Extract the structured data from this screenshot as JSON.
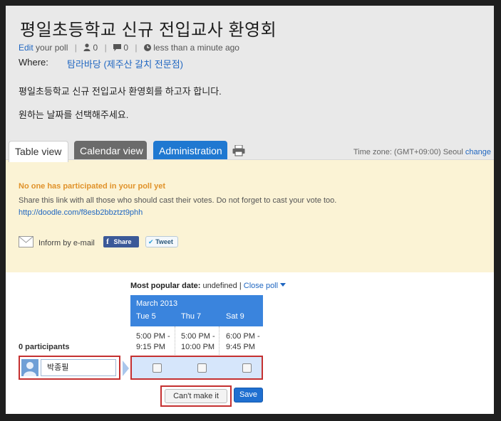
{
  "poll": {
    "title": "평일초등학교 신규 전입교사 환영회",
    "meta": {
      "edit_link": "Edit",
      "edit_suffix": "your poll",
      "participant_count": "0",
      "comment_count": "0",
      "updated": "less than a minute ago"
    },
    "where_label": "Where:",
    "where_value": "탐라바당 (제주산 갈치 전문점)",
    "description_line1": "평일초등학교 신규 전입교사 환영회를 하고자 합니다.",
    "description_line2": "원하는 날짜를 선택해주세요."
  },
  "tabs": {
    "table_view": "Table view",
    "calendar_view": "Calendar view",
    "administration": "Administration"
  },
  "timezone": {
    "label": "Time zone: (GMT+09:00) Seoul",
    "change_link": "change"
  },
  "notice": {
    "title": "No one has participated in your poll yet",
    "text": "Share this link with all those who should cast their votes. Do not forget to cast your vote too.",
    "link": "http://doodle.com/f8esb2bbztzt9phh",
    "email_label": "Inform by e-mail",
    "facebook_label": "Share",
    "twitter_label": "Tweet"
  },
  "popular": {
    "label": "Most popular date:",
    "value": "undefined",
    "separator": "|",
    "close_link": "Close poll"
  },
  "table": {
    "month": "March 2013",
    "participants_label": "0 participants",
    "columns": [
      {
        "day": "Tue 5",
        "time_start": "5:00 PM -",
        "time_end": "9:15 PM"
      },
      {
        "day": "Thu 7",
        "time_start": "5:00 PM -",
        "time_end": "10:00 PM"
      },
      {
        "day": "Sat 9",
        "time_start": "6:00 PM -",
        "time_end": "9:45 PM"
      }
    ],
    "name_value": "박종필"
  },
  "buttons": {
    "cant_make_it": "Can't make it",
    "save": "Save"
  },
  "colors": {
    "link": "#1f66c1",
    "admin_tab": "#1f78d1",
    "calendar_tab": "#6b6b6b",
    "notice_bg": "#fbf3d5",
    "notice_title": "#e0922a",
    "date_header": "#3a84dd",
    "highlight_border": "#c53030",
    "save_button": "#1f6fd0"
  }
}
